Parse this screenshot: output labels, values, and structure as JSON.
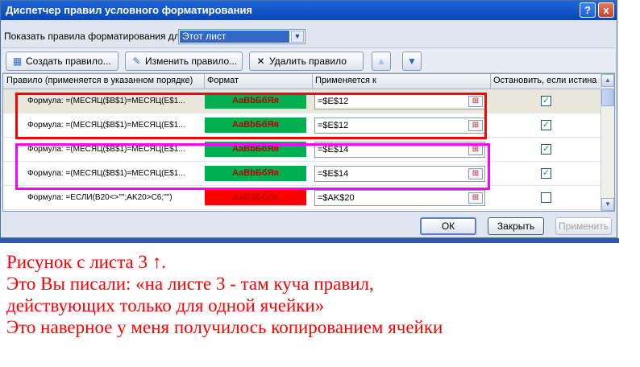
{
  "window": {
    "title": "Диспетчер правил условного форматирования",
    "help_icon": "?",
    "close_icon": "x"
  },
  "show_rules": {
    "label": "Показать правила форматирования для:",
    "selected": "Этот лист"
  },
  "toolbar": {
    "create_label": "Создать правило...",
    "edit_label": "Изменить правило...",
    "delete_label": "Удалить правило",
    "move_up_icon": "arrow-up-icon",
    "move_down_icon": "arrow-down-icon"
  },
  "table": {
    "columns": [
      "Правило (применяется в указанном порядке)",
      "Формат",
      "Применяется к",
      "Остановить, если истина"
    ],
    "rows": [
      {
        "rule": "Формула: =(МЕСЯЦ($B$1)=МЕСЯЦ(E$1...",
        "format": "АаВbБбЯя",
        "format_color": "#00b050",
        "applies_to": "=$E$12",
        "stop": true,
        "selected": true
      },
      {
        "rule": "Формула: =(МЕСЯЦ($B$1)=МЕСЯЦ(E$1...",
        "format": "АаВbБбЯя",
        "format_color": "#00b050",
        "applies_to": "=$E$12",
        "stop": true,
        "selected": false
      },
      {
        "rule": "Формула: =(МЕСЯЦ($B$1)=МЕСЯЦ(E$1...",
        "format": "АаВbБбЯя",
        "format_color": "#00b050",
        "applies_to": "=$E$14",
        "stop": true,
        "selected": false
      },
      {
        "rule": "Формула: =(МЕСЯЦ($B$1)=МЕСЯЦ(E$1...",
        "format": "АаВbБбЯя",
        "format_color": "#00b050",
        "applies_to": "=$E$14",
        "stop": true,
        "selected": false
      },
      {
        "rule": "Формула: =ЕСЛИ(B20<>\"\";AK20>C6;\"\")",
        "format": "АаВbБбЯя",
        "format_color": "#ff0000",
        "applies_to": "=$AK$20",
        "stop": false,
        "selected": false
      }
    ]
  },
  "buttons": {
    "ok": "ОК",
    "close": "Закрыть",
    "apply": "Применить"
  },
  "annotation": {
    "lines": [
      "Рисунок с листа 3 ↑.",
      "Это Вы писали: «на листе 3 - там куча правил,",
      "действующих только для одной ячейки»",
      "Это наверное у меня получилось копированием ячейки"
    ]
  },
  "colors": {
    "title_bar": "#0a46b8",
    "highlight_red": "#ff0000",
    "highlight_magenta": "#ff00ff",
    "format_green": "#00b050",
    "annotation_text": "#ff0000"
  }
}
